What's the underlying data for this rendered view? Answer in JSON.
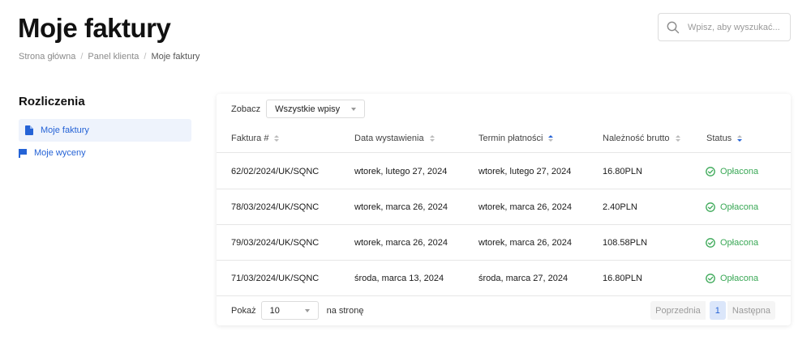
{
  "header": {
    "title": "Moje faktury",
    "breadcrumb": [
      "Strona główna",
      "Panel klienta",
      "Moje faktury"
    ],
    "breadcrumb_separator": "/"
  },
  "search": {
    "placeholder": "Wpisz, aby wyszukać...",
    "value": "",
    "icon": "search-icon"
  },
  "sidebar": {
    "title": "Rozliczenia",
    "items": [
      {
        "label": "Moje faktury",
        "icon": "document-icon",
        "active": true
      },
      {
        "label": "Moje wyceny",
        "icon": "flag-icon",
        "active": false
      }
    ]
  },
  "filter": {
    "label": "Zobacz",
    "selected": "Wszystkie wpisy"
  },
  "table": {
    "columns": [
      {
        "label": "Faktura #",
        "sort": "none"
      },
      {
        "label": "Data wystawienia",
        "sort": "none"
      },
      {
        "label": "Termin płatności",
        "sort": "asc"
      },
      {
        "label": "Należność brutto",
        "sort": "none"
      },
      {
        "label": "Status",
        "sort": "desc"
      }
    ],
    "rows": [
      {
        "invoice": "62/02/2024/UK/SQNC",
        "issued": "wtorek, lutego 27, 2024",
        "due": "wtorek, lutego 27, 2024",
        "amount": "16.80PLN",
        "status": "Opłacona"
      },
      {
        "invoice": "78/03/2024/UK/SQNC",
        "issued": "wtorek, marca 26, 2024",
        "due": "wtorek, marca 26, 2024",
        "amount": "2.40PLN",
        "status": "Opłacona"
      },
      {
        "invoice": "79/03/2024/UK/SQNC",
        "issued": "wtorek, marca 26, 2024",
        "due": "wtorek, marca 26, 2024",
        "amount": "108.58PLN",
        "status": "Opłacona"
      },
      {
        "invoice": "71/03/2024/UK/SQNC",
        "issued": "środa, marca 13, 2024",
        "due": "środa, marca 27, 2024",
        "amount": "16.80PLN",
        "status": "Opłacona"
      }
    ]
  },
  "footer": {
    "show_label": "Pokaż",
    "per_page": "10",
    "per_page_suffix": "na stronę"
  },
  "pagination": {
    "prev": "Poprzednia",
    "current": "1",
    "next": "Następna"
  },
  "colors": {
    "accent": "#2563d6",
    "paid": "#3aa856",
    "active_bg": "#eef3fc"
  }
}
